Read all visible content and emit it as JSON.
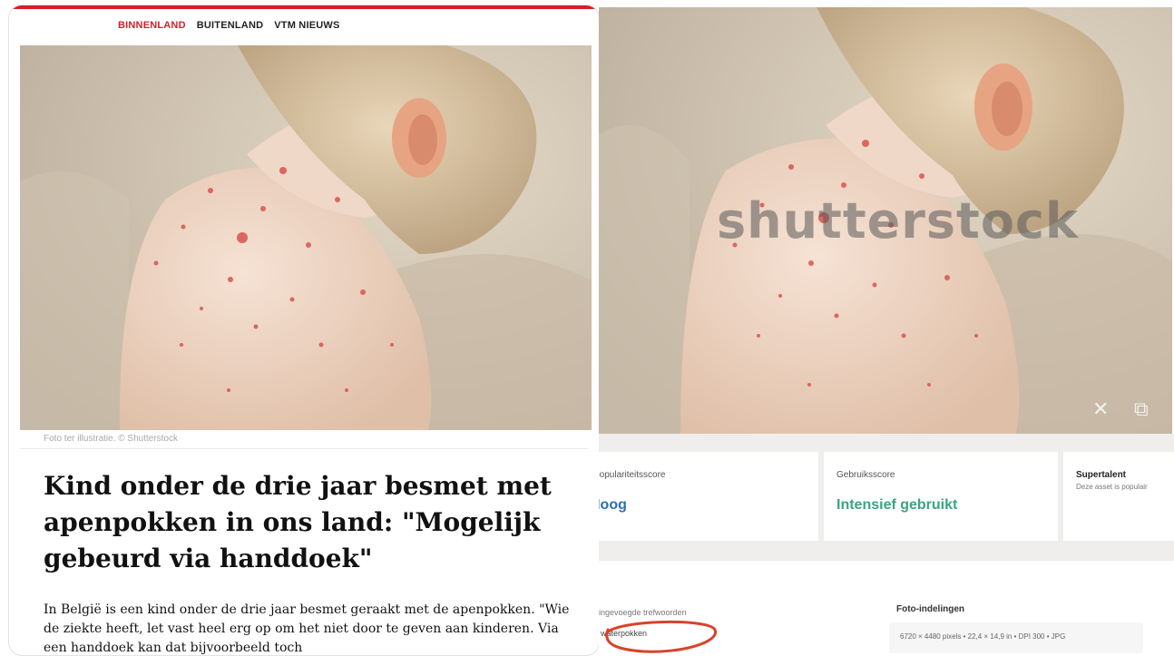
{
  "article": {
    "nav": [
      "BINNENLAND",
      "BUITENLAND",
      "VTM NIEUWS"
    ],
    "caption": "Foto ter illustratie. © Shutterstock",
    "headline": "Kind onder de drie jaar besmet met apenpokken in ons land: \"Mogelijk gebeurd via handdoek\"",
    "body": "In België is een kind onder de drie jaar besmet geraakt met de apenpokken. \"Wie de ziekte heeft, let vast heel erg op om het niet door te geven aan kinderen. Via een handdoek kan dat bijvoorbeeld toch"
  },
  "stock": {
    "watermark": "shutterstock",
    "cards": [
      {
        "label": "Populariteitsscore",
        "value": "Hoog"
      },
      {
        "label": "Gebruiksscore",
        "value": "Intensief gebruikt"
      },
      {
        "label": "Supertalent",
        "sub": "Deze asset is populair"
      }
    ],
    "keyword_partial": "ingevoegde trefwoorden",
    "keyword": "waterpokken",
    "formats_label": "Foto-indelingen",
    "formats_value": "6720 × 4480 pixels • 22,4 × 14,9 in • DPI 300 • JPG"
  },
  "colors": {
    "accent": "#d6202a",
    "green": "#3aa57e",
    "blue": "#2c6fb3",
    "circle": "#d8432c"
  }
}
